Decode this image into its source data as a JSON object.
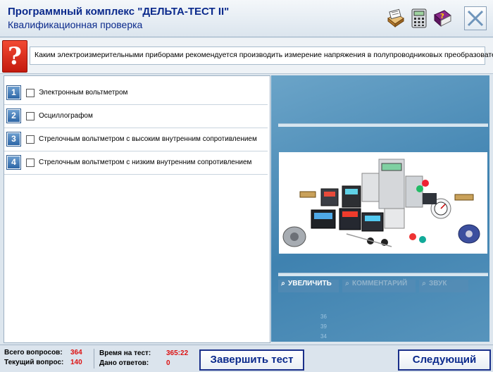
{
  "window": {
    "title": "Программный комплекс \"ДЕЛЬТА-ТЕСТ II\"",
    "subtitle": "Квалификационная проверка"
  },
  "toolbar": {
    "icons": [
      "notes-icon",
      "calculator-icon",
      "help-book-icon",
      "close-icon"
    ]
  },
  "question": {
    "text": "Каким электроизмерительными приборами рекомендуется производить измерение напряжения в полупроводниковых преобразователях?"
  },
  "answers": [
    {
      "num": "1",
      "text": "Электронным вольтметром",
      "checked": false
    },
    {
      "num": "2",
      "text": "Осциллографом",
      "checked": false
    },
    {
      "num": "3",
      "text": "Стрелочным вольтметром с высоким внутренним сопротивлением",
      "checked": false
    },
    {
      "num": "4",
      "text": "Стрелочным вольтметром с низким внутренним сопротивлением",
      "checked": false
    }
  ],
  "media": {
    "zoom_label": "УВЕЛИЧИТЬ",
    "comment_label": "КОММЕНТАРИЙ",
    "sound_label": "ЗВУК",
    "bg_numbers": [
      "36",
      "39",
      "34"
    ]
  },
  "status": {
    "total_label": "Всего вопросов:",
    "total_value": "364",
    "current_label": "Текущий вопрос:",
    "current_value": "140",
    "time_label": "Время на тест:",
    "time_value": "365:22",
    "answered_label": "Дано ответов:",
    "answered_value": "0",
    "finish_label": "Завершить тест",
    "next_label": "Следующий"
  },
  "colors": {
    "title_blue": "#0b2a8c",
    "question_mark_red": "#d8281a",
    "status_value_red": "#dd1111"
  }
}
